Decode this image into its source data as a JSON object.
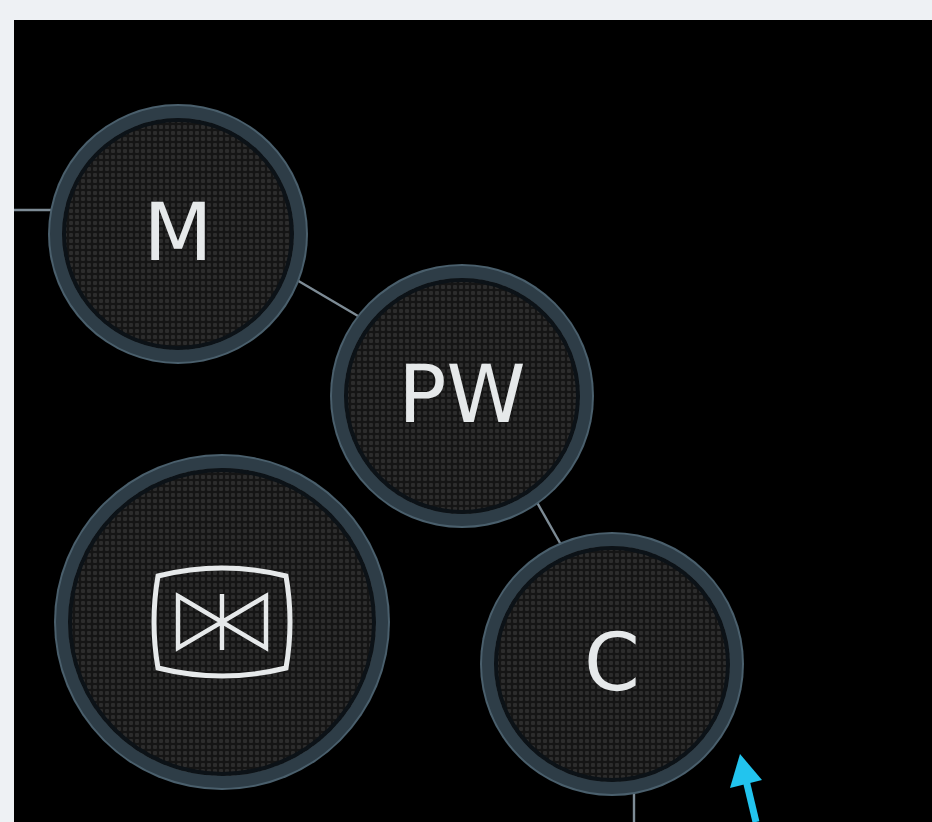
{
  "mode_buttons": [
    {
      "kind": "text",
      "label": "M"
    },
    {
      "kind": "text",
      "label": "PW"
    },
    {
      "kind": "icon"
    },
    {
      "kind": "text",
      "label": "C"
    }
  ]
}
